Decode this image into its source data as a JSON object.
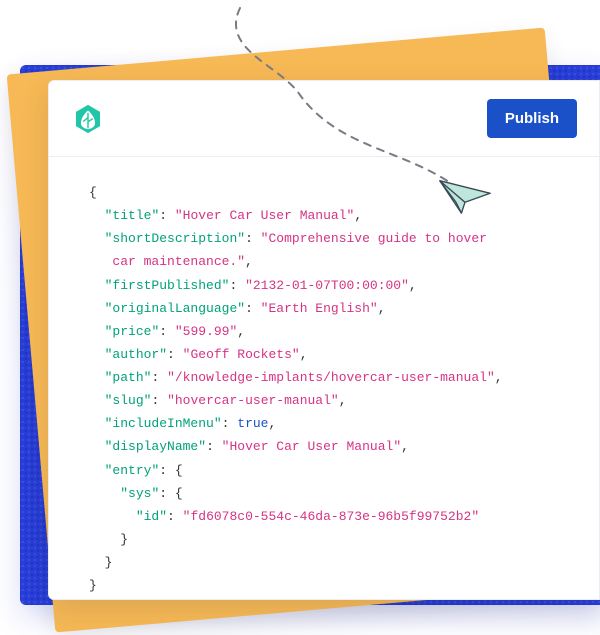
{
  "header": {
    "publish_label": "Publish",
    "logo_name": "leaf-logo"
  },
  "code": {
    "open_brace": "{",
    "close_brace": "}",
    "indent1": "  ",
    "indent2": "    ",
    "indent3": "      ",
    "indent_wrap": "   ",
    "quote": "\"",
    "colon_sp": ": ",
    "comma": ",",
    "fields": {
      "title": {
        "key": "title",
        "value": "Hover Car User Manual"
      },
      "shortDescription": {
        "key": "shortDescription",
        "value_line1": "Comprehensive guide to hover",
        "value_line2": "car maintenance."
      },
      "firstPublished": {
        "key": "firstPublished",
        "value": "2132-01-07T00:00:00"
      },
      "originalLanguage": {
        "key": "originalLanguage",
        "value": "Earth English"
      },
      "price": {
        "key": "price",
        "value": "599.99"
      },
      "author": {
        "key": "author",
        "value": "Geoff Rockets"
      },
      "path": {
        "key": "path",
        "value": "/knowledge-implants/hovercar-user-manual"
      },
      "slug": {
        "key": "slug",
        "value": "hovercar-user-manual"
      },
      "includeInMenu": {
        "key": "includeInMenu",
        "bool": "true"
      },
      "displayName": {
        "key": "displayName",
        "value": "Hover Car User Manual"
      },
      "entry": {
        "key": "entry"
      },
      "sys": {
        "key": "sys"
      },
      "id": {
        "key": "id",
        "value": "fd6078c0-554c-46da-873e-96b5f99752b2"
      }
    }
  }
}
